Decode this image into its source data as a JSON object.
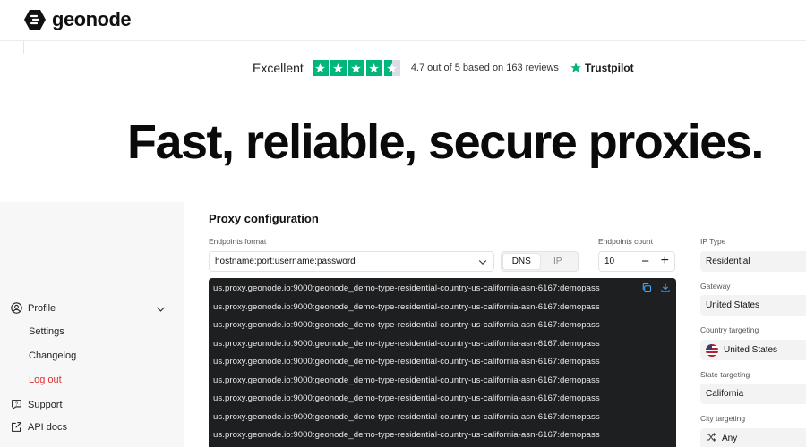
{
  "brand": {
    "name": "geonode"
  },
  "trustpilot": {
    "rating_word": "Excellent",
    "stars": 4.5,
    "summary": "4.7 out of 5 based on 163 reviews",
    "logo_text": "Trustpilot",
    "star_color": "#00b67a"
  },
  "hero": {
    "headline": "Fast, reliable, secure proxies."
  },
  "menu": {
    "profile": "Profile",
    "settings": "Settings",
    "changelog": "Changelog",
    "logout": "Log out",
    "support": "Support",
    "api_docs": "API docs"
  },
  "config": {
    "title": "Proxy configuration",
    "endpoints_format_label": "Endpoints format",
    "endpoints_format_value": "hostname:port:username:password",
    "mode_options": [
      "DNS",
      "IP"
    ],
    "mode_selected": "DNS",
    "endpoints_count_label": "Endpoints count",
    "endpoints_count_value": "10",
    "endpoints": [
      "us.proxy.geonode.io:9000:geonode_demo-type-residential-country-us-california-asn-6167:demopass",
      "us.proxy.geonode.io:9000:geonode_demo-type-residential-country-us-california-asn-6167:demopass",
      "us.proxy.geonode.io:9000:geonode_demo-type-residential-country-us-california-asn-6167:demopass",
      "us.proxy.geonode.io:9000:geonode_demo-type-residential-country-us-california-asn-6167:demopass",
      "us.proxy.geonode.io:9000:geonode_demo-type-residential-country-us-california-asn-6167:demopass",
      "us.proxy.geonode.io:9000:geonode_demo-type-residential-country-us-california-asn-6167:demopass",
      "us.proxy.geonode.io:9000:geonode_demo-type-residential-country-us-california-asn-6167:demopass",
      "us.proxy.geonode.io:9000:geonode_demo-type-residential-country-us-california-asn-6167:demopass",
      "us.proxy.geonode.io:9000:geonode_demo-type-residential-country-us-california-asn-6167:demopass"
    ]
  },
  "targeting": {
    "ip_type_label": "IP Type",
    "ip_type_value": "Residential",
    "gateway_label": "Gateway",
    "gateway_value": "United States",
    "country_label": "Country targeting",
    "country_value": "United States",
    "state_label": "State targeting",
    "state_value": "California",
    "city_label": "City targeting",
    "city_value": "Any"
  },
  "colors": {
    "logout": "#e03131",
    "terminal_bg": "#1e1f20"
  }
}
